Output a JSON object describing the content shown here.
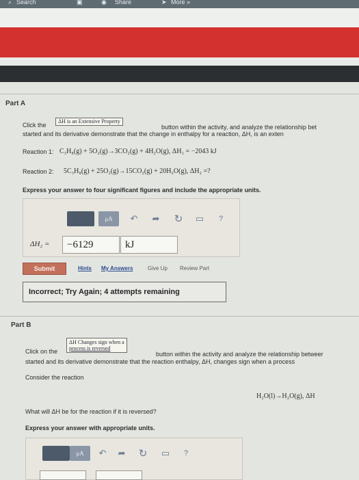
{
  "toolbar": {
    "search_label": "Search",
    "share_label": "Share",
    "more_label": "More »"
  },
  "colors": {
    "accent_red": "#d2312f",
    "dark_band": "#2c2f31",
    "submit": "#c2705c"
  },
  "part_a": {
    "title": "Part A",
    "intro_before": "Click the",
    "property_button": "ΔH is an Extensive Property",
    "intro_after": "button within the activity, and analyze the relationship bet",
    "intro_line2": "started and its derivative demonstrate that the change in enthalpy for a reaction, ΔH, is an exten",
    "reaction1_label": "Reaction 1:",
    "reaction1_eq": "C₃H₈(g) + 5O₂(g)→3CO₂(g) + 4H₂O(g), ΔH₁ = −2043 kJ",
    "reaction2_label": "Reaction 2:",
    "reaction2_eq": "5C₃H₈(g) + 25O₂(g)→15CO₂(g) + 20H₂O(g), ΔH₂ =?",
    "instruction": "Express your answer to four significant figures and include the appropriate units.",
    "answer_label": "ΔH₂ =",
    "answer_value": "−6129",
    "answer_unit": "kJ",
    "submit_label": "Submit",
    "hints_label": "Hints",
    "my_answers_label": "My Answers",
    "give_up_label": "Give Up",
    "review_part_label": "Review Part",
    "feedback": "Incorrect; Try Again; 4 attempts remaining"
  },
  "tools": {
    "mu_label": "μA",
    "help_label": "?"
  },
  "part_b": {
    "title": "Part B",
    "button_line1": "ΔH Changes sign when a",
    "button_line2": "process is reversed",
    "intro_before": "Click on the",
    "intro_after": "button within the activity and analyze the relationship betweer",
    "intro_line2": "started and its derivative demonstrate that the reaction enthalpy, ΔH, changes sign when a process",
    "consider": "Consider the reaction",
    "reaction": "H₂O(l)→H₂O(g), ΔH",
    "question": "What will ΔH be for the reaction if it is reversed?",
    "instruction": "Express your answer with appropriate units."
  }
}
